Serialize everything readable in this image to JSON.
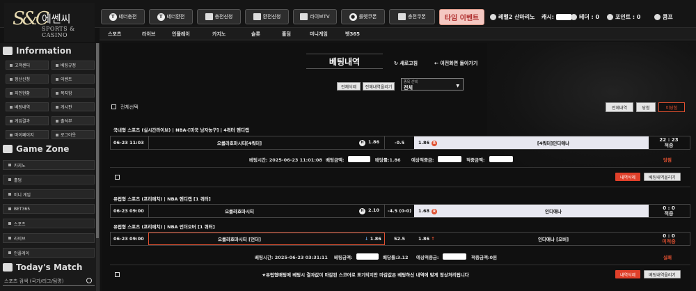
{
  "logo": {
    "mark": "S&C",
    "korean": "에쎈씨",
    "english": "SPORTS & CASINO"
  },
  "topnav": [
    {
      "label": "테더충전",
      "icon": "tether-icon"
    },
    {
      "label": "테더환전",
      "icon": "tether-icon"
    },
    {
      "label": "충전신청",
      "icon": "deposit-icon"
    },
    {
      "label": "환전신청",
      "icon": "withdraw-icon"
    },
    {
      "label": "라이브TV",
      "icon": "tv-icon"
    },
    {
      "label": "룰렛쿠폰",
      "icon": "roulette-icon"
    },
    {
      "label": "충전쿠폰",
      "icon": "coupon-icon"
    }
  ],
  "event_button": "타임 이벤트",
  "user": {
    "level": "레벨2 산마리노",
    "cash_label": "캐시:",
    "tether_label": "테더 : 0",
    "point_label": "포인트 : 0",
    "comp_label": "콤프"
  },
  "subnav": [
    "스포츠",
    "라이브",
    "인플레이",
    "카지노",
    "슬롯",
    "홀덤",
    "미니게임",
    "벳365"
  ],
  "sidebar": {
    "info_title": "Information",
    "info_buttons": [
      "고객센터",
      "베팅규정",
      "정산신청",
      "이벤트",
      "지인현황",
      "복지함",
      "베팅내역",
      "게시판",
      "게임결과",
      "출석부",
      "마이페이지",
      "로그아웃"
    ],
    "zone_title": "Game Zone",
    "zone_items": [
      "카지노",
      "홀덤",
      "미니 게임",
      "BET365",
      "스포츠",
      "라이브",
      "인플레이"
    ],
    "match_title": "Today's Match",
    "search_placeholder": "스포츠 검색 (국가/리그/팀명)"
  },
  "page": {
    "title": "베팅내역",
    "refresh": "새로고침",
    "back": "이전화면 돌아가기",
    "delete_all": "전체삭제",
    "upload_all": "전체내역올리기",
    "filter_label": "종목 선택",
    "filter_value": "전체",
    "select_all": "전체선택",
    "tabs": [
      "전체내역",
      "당첨",
      "미당첨"
    ]
  },
  "bets": [
    {
      "title": "국내형 스포츠 (실시간라이브) | NBA-[미국 남자농구] | 4쿼터 핸디캡",
      "lines": [
        {
          "time": "06-23 11:03",
          "home": "오클라호마시티[4쿼터]",
          "home_odds": "1.86",
          "handicap": "-0.5",
          "away_odds": "1.86",
          "away": "[4쿼터]인디애나",
          "result_top": "22 : 23",
          "result_bottom": "적중",
          "badge": "H",
          "away_badge": "R"
        }
      ],
      "summary": {
        "bet_time": "베팅시간: 2025-06-23 11:01:08",
        "bet_amount": "베팅금액:",
        "bet_odds": "배당률:1.86",
        "expected": "예상적중금:",
        "win_amount": "적중금액:",
        "status": "당첨"
      },
      "buttons": [
        "내역삭제",
        "베팅내역올리기"
      ]
    },
    {
      "title1": "유럽형 스포츠 (프리매치) | NBA 핸디캡 [1 쿼터]",
      "title2": "유럽형 스포츠 (프리매치) | NBA 언더오버 [1 쿼터]",
      "lines": [
        {
          "time": "06-23 09:00",
          "home": "오클라호마시티",
          "home_odds": "2.10",
          "handicap": "-4.5 (0-0)",
          "away_odds": "1.68",
          "away": "인디애나",
          "result_top": "0 : 0",
          "result_bottom": "적중",
          "badge": "H",
          "away_badge": "R"
        },
        {
          "time": "06-23 09:00",
          "home": "오클라호마시티 [언더]",
          "home_odds": "1.86",
          "handicap": "52.5",
          "away_odds": "1.86",
          "away": "인디애나 [오버]",
          "result_top": "0 : 0",
          "result_bottom": "미적중",
          "up": "↑",
          "down": "↓"
        }
      ],
      "summary": {
        "bet_time": "베팅시간: 2025-06-23 03:31:11",
        "bet_amount": "베팅금액:",
        "bet_odds": "배당률:3.12",
        "expected": "예상적중금:",
        "win_amount": "적중금액:0원",
        "status": "실패"
      },
      "notice": "★유럽형배팅에 베팅시 결과값이 마감된 스코어로 표기되지만 마감값은 베팅하신 내역에 맞게 정상처리됩니다",
      "buttons": [
        "내역삭제",
        "베팅내역올리기"
      ]
    }
  ],
  "colors": {
    "accent": "#e0402a",
    "win": "#e05030",
    "event_bg": "#f4c8c2"
  }
}
